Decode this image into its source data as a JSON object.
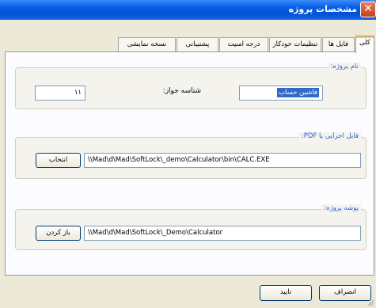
{
  "window": {
    "title": "مشخصات پروژه",
    "close_glyph": "✕",
    "accent": "#0a5fe8"
  },
  "tabs": [
    {
      "label": "کلی",
      "active": true
    },
    {
      "label": "فایل ها"
    },
    {
      "label": "تنظیمات خودکار"
    },
    {
      "label": "درجه امنیت"
    },
    {
      "label": "پشتیبانی"
    },
    {
      "label": "نسخه نمایشی"
    }
  ],
  "project_name_group": {
    "legend": "نام پروژه:",
    "name_value": "فاشین حساب",
    "license_id_label": "شناسه جواز:",
    "license_id_value": "۱۱"
  },
  "executable_group": {
    "legend": "فایل اجرایی یا PDF:",
    "path_value": "\\\\Mad\\d\\Mad\\SoftLock\\_demo\\Calculator\\bin\\CALC.EXE",
    "browse_label": "انتخاب"
  },
  "folder_group": {
    "legend": "پوشه پروژه:",
    "path_value": "\\\\Mad\\d\\Mad\\SoftLock\\_Demo\\Calculator",
    "open_label": "باز کردن"
  },
  "footer": {
    "ok_label": "تایید",
    "cancel_label": "انصراف"
  }
}
